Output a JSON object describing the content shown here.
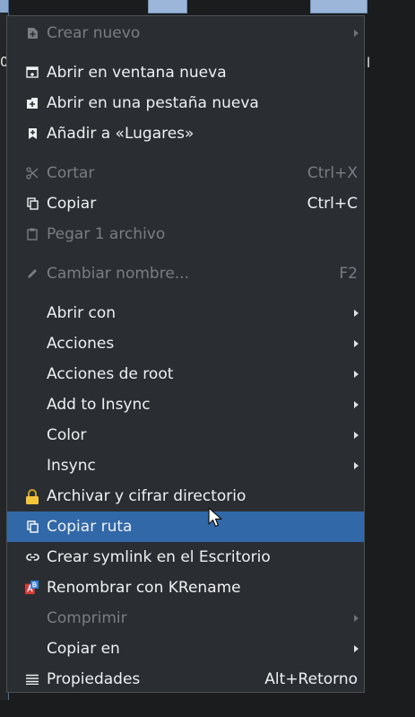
{
  "background": {
    "fragments": [
      "0",
      "l"
    ]
  },
  "menu": {
    "items": [
      {
        "label": "Crear nuevo",
        "icon": "file-plus-icon",
        "disabled": true,
        "submenu": true
      },
      {
        "label": "Abrir en ventana nueva",
        "icon": "new-window-icon"
      },
      {
        "label": "Abrir en una pestaña nueva",
        "icon": "new-tab-icon"
      },
      {
        "label": "Añadir a «Lugares»",
        "icon": "bookmark-plus-icon"
      },
      {
        "label": "Cortar",
        "icon": "scissors-icon",
        "disabled": true,
        "shortcut": "Ctrl+X"
      },
      {
        "label": "Copiar",
        "icon": "copy-icon",
        "shortcut": "Ctrl+C"
      },
      {
        "label": "Pegar 1 archivo",
        "icon": "clipboard-icon",
        "disabled": true
      },
      {
        "label": "Cambiar nombre...",
        "icon": "pencil-icon",
        "disabled": true,
        "shortcut": "F2"
      },
      {
        "label": "Abrir con",
        "submenu": true
      },
      {
        "label": "Acciones",
        "submenu": true
      },
      {
        "label": "Acciones de root",
        "submenu": true
      },
      {
        "label": "Add to Insync",
        "submenu": true
      },
      {
        "label": "Color",
        "submenu": true
      },
      {
        "label": "Insync",
        "submenu": true
      },
      {
        "label": "Archivar y cifrar directorio",
        "icon": "lock-icon"
      },
      {
        "label": "Copiar ruta",
        "icon": "copy-icon",
        "selected": true
      },
      {
        "label": "Crear symlink en el Escritorio",
        "icon": "link-icon"
      },
      {
        "label": "Renombrar con KRename",
        "icon": "krename-icon"
      },
      {
        "label": "Comprimir",
        "disabled": true,
        "submenu": true
      },
      {
        "label": "Copiar en",
        "submenu": true
      },
      {
        "label": "Propiedades",
        "icon": "list-icon",
        "shortcut": "Alt+Retorno"
      }
    ]
  }
}
